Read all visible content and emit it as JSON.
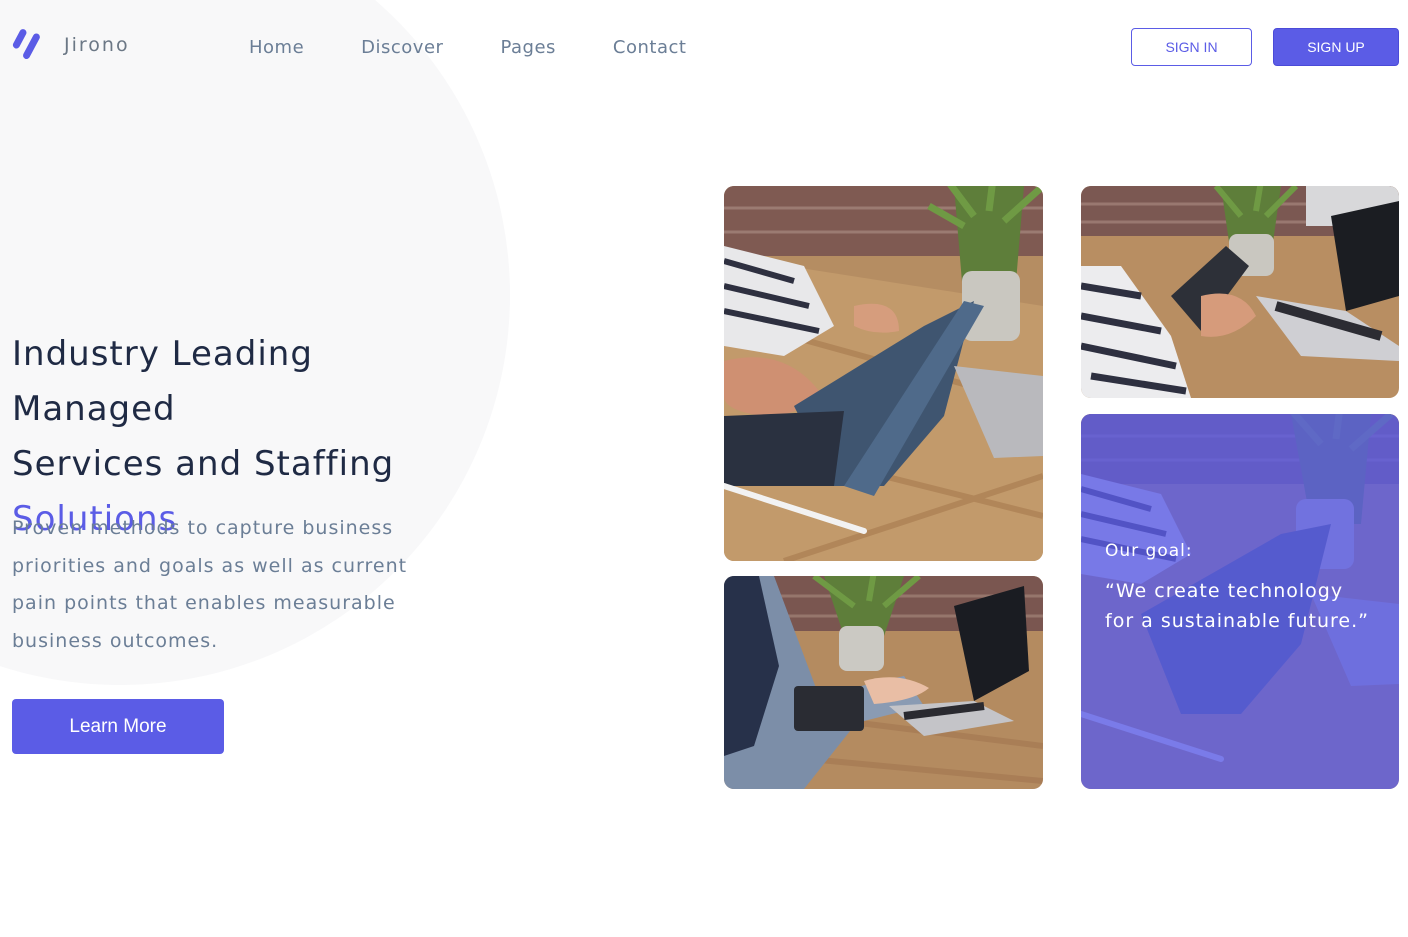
{
  "brand": {
    "name": "Jirono",
    "accent_color": "#5b5ce6",
    "logo_icon": "slashes-logo-icon"
  },
  "nav": {
    "items": [
      "Home",
      "Discover",
      "Pages",
      "Contact"
    ]
  },
  "auth": {
    "sign_in": "SIGN IN",
    "sign_up": "SIGN UP"
  },
  "hero": {
    "title_line1": "Industry Leading Managed",
    "title_line2": "Services and Staffing",
    "title_accent": "Solutions",
    "description": "Proven methods to capture business priorities and goals as well as current pain points that enables measurable business outcomes.",
    "cta": "Learn More"
  },
  "gallery": {
    "goal_label": "Our goal:",
    "goal_quote": "“We create technology for a sustainable future.”"
  }
}
